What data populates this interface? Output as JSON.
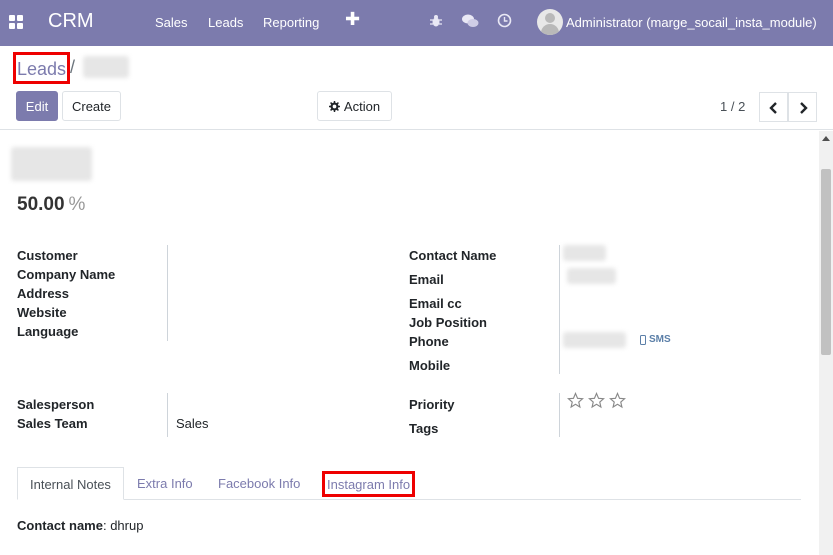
{
  "topbar": {
    "app_name": "CRM",
    "menu": [
      "Sales",
      "Leads",
      "Reporting"
    ],
    "new_symbol": "✚",
    "user_name": "Administrator (marge_socail_insta_module)",
    "bg_color": "#7c7bad"
  },
  "breadcrumb": {
    "parent": "Leads",
    "separator": "/"
  },
  "toolbar": {
    "edit_label": "Edit",
    "create_label": "Create",
    "action_label": "Action",
    "action_icon": "gear-icon"
  },
  "pager": {
    "value": "1 / 2"
  },
  "record": {
    "probability": "50.00",
    "probability_unit": "%",
    "left_labels": [
      "Customer",
      "Company Name",
      "Address",
      "Website",
      "Language"
    ],
    "right_labels": [
      "Contact Name",
      "Email",
      "Email cc",
      "Job Position",
      "Phone",
      "Mobile"
    ],
    "sms_label": "SMS",
    "salesperson_label": "Salesperson",
    "sales_team_label": "Sales Team",
    "sales_team_value": "Sales",
    "priority_label": "Priority",
    "tags_label": "Tags",
    "priority_stars": 0
  },
  "tabs": [
    "Internal Notes",
    "Extra Info",
    "Facebook Info",
    "Instagram Info"
  ],
  "notes": {
    "label": "Contact name",
    "value": ": dhrup"
  }
}
